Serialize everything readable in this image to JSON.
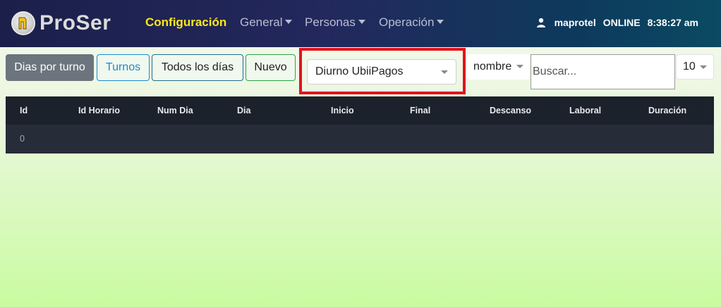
{
  "app": {
    "brand": "ProSer"
  },
  "nav": {
    "configuracion": "Configuración",
    "general": "General",
    "personas": "Personas",
    "operacion": "Operación"
  },
  "user": {
    "name": "maprotel",
    "status": "ONLINE",
    "time": "8:38:27 am"
  },
  "toolbar": {
    "dias_por_turno": "Dias por turno",
    "turnos": "Turnos",
    "todos_los_dias": "Todos los días",
    "nuevo": "Nuevo",
    "turno_selected": "Diurno UbiiPagos",
    "campo_selected": "nombre",
    "search_placeholder": "Buscar...",
    "limit_selected": "10"
  },
  "table": {
    "columns": [
      "Id",
      "Id Horario",
      "Num Dia",
      "Dia",
      "Inicio",
      "Final",
      "Descanso",
      "Laboral",
      "Duración"
    ],
    "rows": [
      [
        "0",
        "",
        "",
        "",
        "",
        "",
        "",
        "",
        ""
      ]
    ]
  },
  "colors": {
    "highlight": "#e0141d",
    "nav_active": "#ffe81a",
    "table_bg": "#222a35"
  }
}
